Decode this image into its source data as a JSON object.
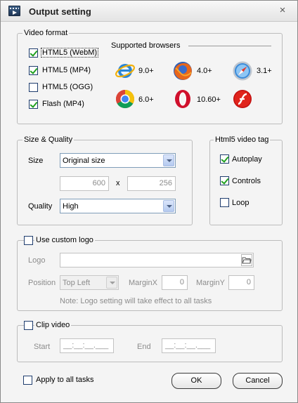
{
  "window": {
    "title": "Output setting"
  },
  "video_format": {
    "label": "Video format",
    "options": [
      {
        "label": "HTML5 (WebM)",
        "checked": true
      },
      {
        "label": "HTML5 (MP4)",
        "checked": true
      },
      {
        "label": "HTML5 (OGG)",
        "checked": false
      },
      {
        "label": "Flash (MP4)",
        "checked": true
      }
    ],
    "browsers_title": "Supported browsers",
    "browsers": [
      {
        "icon": "internet-explorer-icon",
        "version": "9.0+"
      },
      {
        "icon": "firefox-icon",
        "version": "4.0+"
      },
      {
        "icon": "safari-icon",
        "version": "3.1+"
      },
      {
        "icon": "chrome-icon",
        "version": "6.0+"
      },
      {
        "icon": "opera-icon",
        "version": "10.60+"
      },
      {
        "icon": "flash-player-icon",
        "version": ""
      }
    ]
  },
  "size_quality": {
    "label": "Size & Quality",
    "size_label": "Size",
    "size_value": "Original size",
    "width": "600",
    "x_sep": "x",
    "height": "256",
    "quality_label": "Quality",
    "quality_value": "High"
  },
  "html5_tag": {
    "label": "Html5 video tag",
    "options": [
      {
        "label": "Autoplay",
        "checked": true
      },
      {
        "label": "Controls",
        "checked": true
      },
      {
        "label": "Loop",
        "checked": false
      }
    ]
  },
  "custom_logo": {
    "label": "Use custom logo",
    "checked": false,
    "logo_label": "Logo",
    "logo_path": "",
    "position_label": "Position",
    "position_value": "Top Left",
    "marginx_label": "MarginX",
    "marginx_value": "0",
    "marginy_label": "MarginY",
    "marginy_value": "0",
    "note": "Note: Logo setting will take effect to all tasks"
  },
  "clip_video": {
    "label": "Clip video",
    "checked": false,
    "start_label": "Start",
    "start_value": "__:__:__.___",
    "end_label": "End",
    "end_value": "__:__:__.___"
  },
  "footer": {
    "apply_all_label": "Apply to all tasks",
    "apply_all_checked": false,
    "ok_label": "OK",
    "cancel_label": "Cancel"
  },
  "colors": {
    "check": "#20a020",
    "input_border": "#7f9db9",
    "group_border": "#bcbcbc"
  }
}
